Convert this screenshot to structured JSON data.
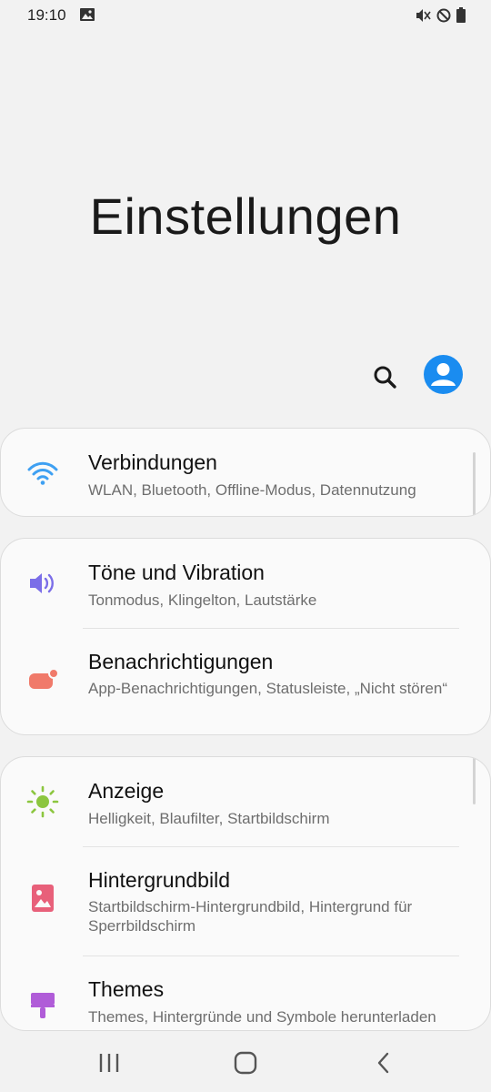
{
  "status_bar": {
    "time": "19:10",
    "icons": [
      "image-icon",
      "mute-vibrate-icon",
      "dnd-icon",
      "battery-icon"
    ]
  },
  "header": {
    "title": "Einstellungen",
    "search_icon": "search-icon",
    "avatar_icon": "account-icon"
  },
  "colors": {
    "background": "#f2f2f2",
    "card": "#fafafa",
    "avatar": "#1a8cf0",
    "wifi": "#3ea0f2",
    "sound": "#7b6ee8",
    "notifications": "#f07a6a",
    "display": "#8cc63f",
    "wallpaper": "#e8607a",
    "themes": "#b05cd8"
  },
  "groups": [
    {
      "items": [
        {
          "title": "Verbindungen",
          "subtitle": "WLAN, Bluetooth, Offline-Modus, Datennutzung",
          "icon": "wifi-icon"
        }
      ]
    },
    {
      "items": [
        {
          "title": "Töne und Vibration",
          "subtitle": "Tonmodus, Klingelton, Lautstärke",
          "icon": "volume-icon"
        },
        {
          "title": "Benachrichtigungen",
          "subtitle": "App-Benachrichtigungen, Statusleiste, „Nicht stören“",
          "icon": "notification-icon"
        }
      ]
    },
    {
      "items": [
        {
          "title": "Anzeige",
          "subtitle": "Helligkeit, Blaufilter, Startbildschirm",
          "icon": "brightness-icon"
        },
        {
          "title": "Hintergrundbild",
          "subtitle": "Startbildschirm-Hintergrundbild, Hintergrund für Sperrbildschirm",
          "icon": "wallpaper-icon"
        },
        {
          "title": "Themes",
          "subtitle": "Themes, Hintergründe und Symbole herunterladen",
          "icon": "themes-icon"
        }
      ]
    }
  ],
  "nav_bar": {
    "recents": "recents-icon",
    "home": "home-icon",
    "back": "back-icon"
  }
}
